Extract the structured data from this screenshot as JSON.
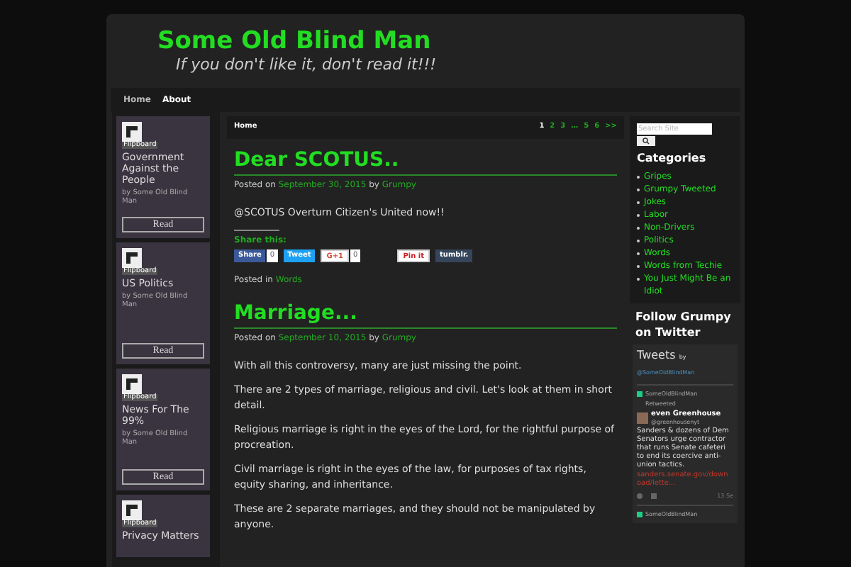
{
  "site": {
    "title": "Some Old Blind Man",
    "tagline": "If you don't like it, don't read it!!!"
  },
  "nav": [
    {
      "label": "Home",
      "selected": false
    },
    {
      "label": "About",
      "selected": true
    }
  ],
  "magazines": [
    {
      "brand": "Flipboard",
      "title": "Government Against the People",
      "byline": "by Some Old Blind Man",
      "button": "Read"
    },
    {
      "brand": "Flipboard",
      "title": "US Politics",
      "byline": "by Some Old Blind Man",
      "button": "Read"
    },
    {
      "brand": "Flipboard",
      "title": "News For The 99%",
      "byline": "by Some Old Blind Man",
      "button": "Read"
    },
    {
      "brand": "Flipboard",
      "title": "Privacy Matters"
    }
  ],
  "breadcrumb": "Home",
  "pagination": [
    {
      "label": "1",
      "selected": true
    },
    {
      "label": "2",
      "selected": false
    },
    {
      "label": "3",
      "selected": false
    },
    {
      "label": "…",
      "selected": false
    },
    {
      "label": "5",
      "selected": false
    },
    {
      "label": "6",
      "selected": false
    },
    {
      "label": ">>",
      "selected": false
    }
  ],
  "posts": [
    {
      "title": "Dear SCOTUS..",
      "posted_on": "Posted on",
      "date": "September 30, 2015",
      "by": "by",
      "author": "Grumpy",
      "paragraphs": [
        "@SCOTUS Overturn Citizen's United now!!"
      ],
      "share": {
        "label": "Share this:",
        "buttons": [
          {
            "kind": "facebook",
            "label": "Share",
            "count": "0"
          },
          {
            "kind": "twitter",
            "label": "Tweet"
          },
          {
            "kind": "google",
            "label": "G+1",
            "count": "0"
          },
          {
            "kind": "pinterest",
            "label": "Pin it"
          },
          {
            "kind": "tumblr",
            "label": "tumblr."
          }
        ]
      },
      "posted_in": "Posted in",
      "category": "Words"
    },
    {
      "title": "Marriage...",
      "posted_on": "Posted on",
      "date": "September 10, 2015",
      "by": "by",
      "author": "Grumpy",
      "paragraphs": [
        "With all this controversy, many are just missing the point.",
        "There are 2 types of marriage, religious and civil. Let's look at them in short detail.",
        "Religious marriage is right in the eyes of the Lord, for the rightful purpose of procreation.",
        "Civil marriage is right in the eyes of the law, for purposes of tax rights, equity sharing, and inheritance.",
        "These are 2 separate marriages, and they should not be manipulated by anyone."
      ]
    }
  ],
  "search": {
    "placeholder": "Search Site"
  },
  "categories": {
    "title": "Categories",
    "items": [
      "Gripes",
      "Grumpy Tweeted",
      "Jokes",
      "Labor",
      "Non-Drivers",
      "Politics",
      "Words",
      "Words from Techie",
      "You Just Might Be an Idiot"
    ]
  },
  "twitter": {
    "title": "Follow Grumpy on Twitter",
    "header": "Tweets",
    "by": "by",
    "handle": "@SomeOldBlindMan",
    "tweets": [
      {
        "account": "SomeOldBlindMan",
        "retweeted": "Retweeted",
        "name": "even Greenhouse",
        "user": "@greenhousenyt",
        "text": "Sanders & dozens of Dem Senators urge contractor that runs Senate cafeteri to end its coercive anti-union tactics.",
        "link": "sanders.senate.gov/down oad/lette...",
        "time": "13 Se"
      },
      {
        "account": "SomeOldBlindMan"
      }
    ]
  }
}
